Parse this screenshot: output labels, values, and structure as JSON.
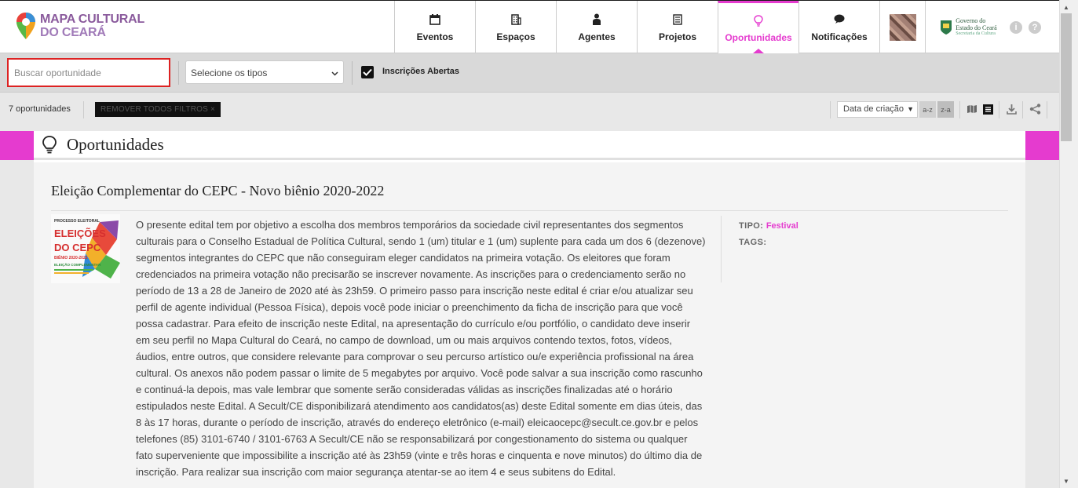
{
  "header": {
    "logo": {
      "line1": "MAPA CULTURAL",
      "line2": "DO CEARÁ"
    },
    "nav": [
      {
        "label": "Eventos",
        "icon": "calendar-icon"
      },
      {
        "label": "Espaços",
        "icon": "building-icon"
      },
      {
        "label": "Agentes",
        "icon": "person-icon"
      },
      {
        "label": "Projetos",
        "icon": "document-icon"
      },
      {
        "label": "Oportunidades",
        "icon": "lightbulb-icon",
        "active": true
      },
      {
        "label": "Notificações",
        "icon": "chat-bubble-icon"
      }
    ],
    "gov": {
      "line1": "Governo do",
      "line2": "Estado do Ceará",
      "line3": "Secretaria da Cultura"
    }
  },
  "filters": {
    "search_placeholder": "Buscar oportunidade",
    "type_select": "Selecione os tipos",
    "open_label": "Inscrições Abertas",
    "open_checked": true
  },
  "results": {
    "count": "7 oportunidades",
    "remove_filters": "REMOVER TODOS FILTROS",
    "sort_value": "Data de criação",
    "sort_az": "a-z",
    "sort_za": "z-a"
  },
  "section": {
    "title": "Oportunidades"
  },
  "opportunity": {
    "title": "Eleição Complementar do CEPC - Novo biênio 2020-2022",
    "thumbnail": {
      "top": "PROCESSO ELEITORAL",
      "line1": "ELEIÇÕES",
      "line2": "DO CEPC",
      "years": "BIÊNIO 2020-2022",
      "sub": "ELEIÇÃO COMPLEMENTAR"
    },
    "description": "O presente edital tem por objetivo a escolha dos membros temporários da sociedade civil representantes dos segmentos culturais para o Conselho Estadual de Política Cultural, sendo 1 (um) titular e 1 (um) suplente para cada um dos 6 (dezenove) segmentos integrantes do CEPC que não conseguiram eleger candidatos na primeira votação. Os eleitores que foram credenciados na primeira votação não precisarão se inscrever novamente. As inscrições para o credenciamento serão no período de 13 a 28 de Janeiro de 2020 até às 23h59. O primeiro passo para inscrição neste edital é criar e/ou atualizar seu perfil de agente individual (Pessoa Física), depois você pode iniciar o preenchimento da ficha de inscrição para que você possa cadastrar. Para efeito de inscrição neste Edital, na apresentação do currículo e/ou portfólio, o candidato deve inserir em seu perfil no Mapa Cultural do Ceará, no campo de download, um ou mais arquivos contendo textos, fotos, vídeos, áudios, entre outros, que considere relevante para comprovar o seu percurso artístico ou/e experiência profissional na área cultural. Os anexos não podem passar o limite de 5 megabytes por arquivo. Você pode salvar a sua inscrição como rascunho e continuá-la depois, mas vale lembrar que somente serão consideradas válidas as inscrições finalizadas até o horário estipulados neste Edital. A Secult/CE disponibilizará atendimento aos candidatos(as) deste Edital somente em dias úteis, das 8 às 17 horas, durante o período de inscrição, através do endereço eletrônico (e-mail) eleicaocepc@secult.ce.gov.br e pelos telefones (85) 3101-6740 / 3101-6763 A Secult/CE não se responsabilizará por congestionamento do sistema ou qualquer fato superveniente que impossibilite a inscrição até às 23h59 (vinte e três horas e cinquenta e nove minutos) do último dia de inscrição. Para realizar sua inscrição com maior segurança atentar-se ao item 4 e seus subitens do Edital.",
    "tipo_label": "TIPO:",
    "tipo_value": "Festival",
    "tags_label": "TAGS:"
  },
  "colors": {
    "accent": "#e53bcf",
    "logo": "#8a5a9c"
  }
}
